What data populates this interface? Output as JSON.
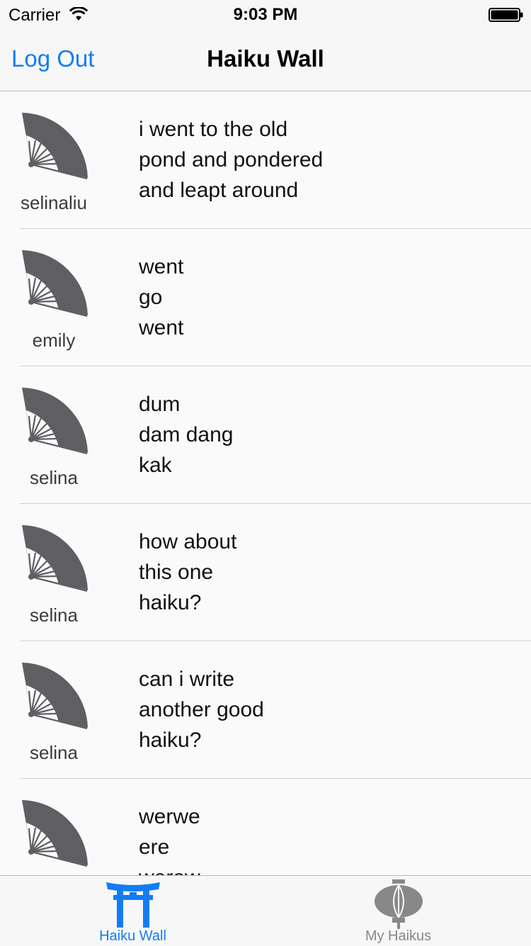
{
  "status_bar": {
    "carrier": "Carrier",
    "time": "9:03 PM"
  },
  "nav": {
    "logout_label": "Log Out",
    "title": "Haiku Wall"
  },
  "feed": [
    {
      "user": "selinaliu",
      "lines": [
        "i went to the old",
        "pond and pondered",
        "and leapt around"
      ]
    },
    {
      "user": "emily",
      "lines": [
        "went",
        "go",
        "went"
      ]
    },
    {
      "user": "selina",
      "lines": [
        "dum",
        "dam dang",
        "kak"
      ]
    },
    {
      "user": "selina",
      "lines": [
        "how about",
        "this one",
        "haiku?"
      ]
    },
    {
      "user": "selina",
      "lines": [
        "can i write",
        "another good",
        "haiku?"
      ]
    },
    {
      "user": "",
      "lines": [
        "werwe",
        "ere",
        "werew"
      ]
    }
  ],
  "avatar_icon": "folding-fan-icon",
  "tabs": [
    {
      "label": "Haiku Wall",
      "icon": "torii-gate-icon",
      "active": true
    },
    {
      "label": "My Haikus",
      "icon": "lantern-icon",
      "active": false
    }
  ],
  "colors": {
    "accent": "#137cf5",
    "inactive": "#888888",
    "fan": "#5f5e62"
  }
}
